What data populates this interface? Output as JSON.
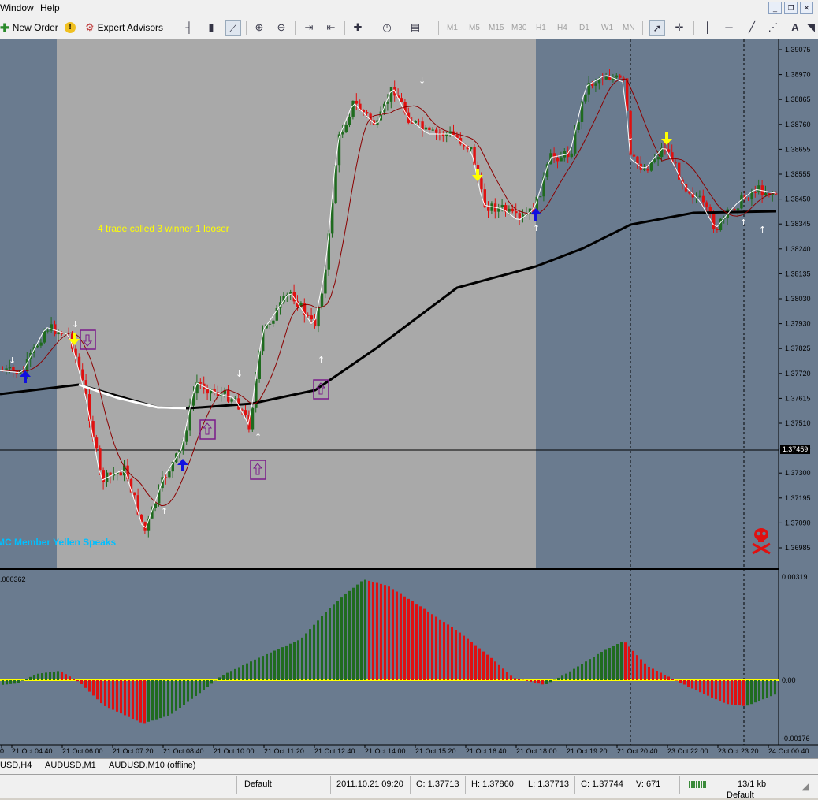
{
  "menu": {
    "window": "Window",
    "help": "Help"
  },
  "window_controls": {
    "minimize": "_",
    "restore": "❐",
    "close": "✕"
  },
  "toolbar": {
    "new_order": "New Order",
    "expert_advisors": "Expert Advisors",
    "timeframes": [
      "M1",
      "M5",
      "M15",
      "M30",
      "H1",
      "H4",
      "D1",
      "W1",
      "MN"
    ],
    "text_tool": "A"
  },
  "chart": {
    "annotation_text": "4 trade called 3 winner  1 looser",
    "news_text": "MC Member Yellen Speaks",
    "price_axis": [
      "1.39075",
      "1.38970",
      "1.38865",
      "1.38760",
      "1.38655",
      "1.38555",
      "1.38450",
      "1.38345",
      "1.38240",
      "1.38135",
      "1.38030",
      "1.37930",
      "1.37825",
      "1.37720",
      "1.37615",
      "1.37510",
      "1.37405",
      "1.37300",
      "1.37195",
      "1.37090",
      "1.36985"
    ],
    "current_price": "1.37459",
    "indicator_top_left": ".000362",
    "indicator_axis": [
      "0.00319",
      "0.00",
      "-0.00176"
    ],
    "time_axis": [
      "0",
      "21 Oct 04:40",
      "21 Oct 06:00",
      "21 Oct 07:20",
      "21 Oct 08:40",
      "21 Oct 10:00",
      "21 Oct 11:20",
      "21 Oct 12:40",
      "21 Oct 14:00",
      "21 Oct 15:20",
      "21 Oct 16:40",
      "21 Oct 18:00",
      "21 Oct 19:20",
      "21 Oct 20:40",
      "23 Oct 22:00",
      "23 Oct 23:20",
      "24 Oct 00:40"
    ],
    "colors": {
      "background": "#6a7b8f",
      "session": "#a9a9a9",
      "bull": "#1f6b1f",
      "bear": "#e01010",
      "ema_fast": "#ffffff",
      "ema_slow": "#8b0000",
      "ema_long": "#000000",
      "zero_line": "#ffff00",
      "news": "#00bfff",
      "annotation": "#ffff00"
    }
  },
  "tabs": [
    "USD,H4",
    "AUDUSD,M1",
    "AUDUSD,M10 (offline)"
  ],
  "status": {
    "profile": "Default",
    "datetime": "2011.10.21 09:20",
    "open": "O: 1.37713",
    "high": "H: 1.37860",
    "low": "L: 1.37713",
    "close": "C: 1.37744",
    "volume": "V: 671",
    "traffic": "13/1 kb",
    "profile_bottom": "Default"
  }
}
